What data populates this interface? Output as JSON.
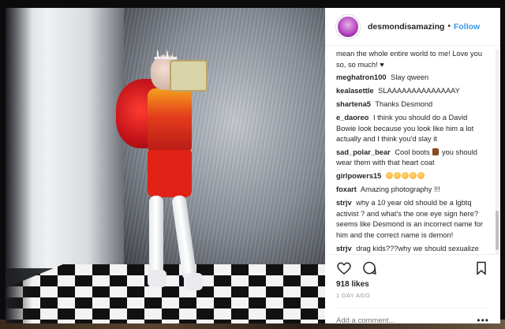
{
  "colors": {
    "accent_follow": "#3897f0",
    "text_primary": "#262626",
    "text_muted": "#999999",
    "backdrop": "#0b0b0b"
  },
  "header": {
    "username": "desmondisamazing",
    "separator": "•",
    "follow_label": "Follow",
    "avatar_icon": "profile-avatar"
  },
  "comments": [
    {
      "user": "",
      "text": "mean the whole entire world to me! Love you so, so much! ♥"
    },
    {
      "user": "meghatron100",
      "text": "Slay qween"
    },
    {
      "user": "kealasettle",
      "text": "SLAAAAAAAAAAAAAAY"
    },
    {
      "user": "shartena5",
      "text": "Thanks Desmond"
    },
    {
      "user": "e_daoreo",
      "text": "I think you should do a David Bowie look because you look like him a lot actually and I think you'd slay it"
    },
    {
      "user": "sad_polar_bear",
      "text_before": "Cool boots",
      "text_after": "you should wear them with that heart coat",
      "emoji": "boot-emoji"
    },
    {
      "user": "girlpowers15",
      "emoji": "face-emoji",
      "emoji_count": 5
    },
    {
      "user": "foxart",
      "text": "Amazing photography !!!"
    },
    {
      "user": "strjv",
      "text": "why a 10 year old should be a lgbtq activist ? and what's the one eye sign here? seems like Desmond is an incorrect name for him and the correct name is demon!"
    },
    {
      "user": "strjv",
      "text": "drag kids???why we should sexualize kids ???nonsense"
    }
  ],
  "actions": {
    "like_icon": "heart-icon",
    "comment_icon": "comment-icon",
    "save_icon": "bookmark-icon"
  },
  "likes_label": "918 likes",
  "timestamp": "1 DAY AGO",
  "add_comment": {
    "placeholder": "Add a comment...",
    "more_label": "•••"
  },
  "backdrop": {
    "corner_icon": "gallery-icon"
  }
}
